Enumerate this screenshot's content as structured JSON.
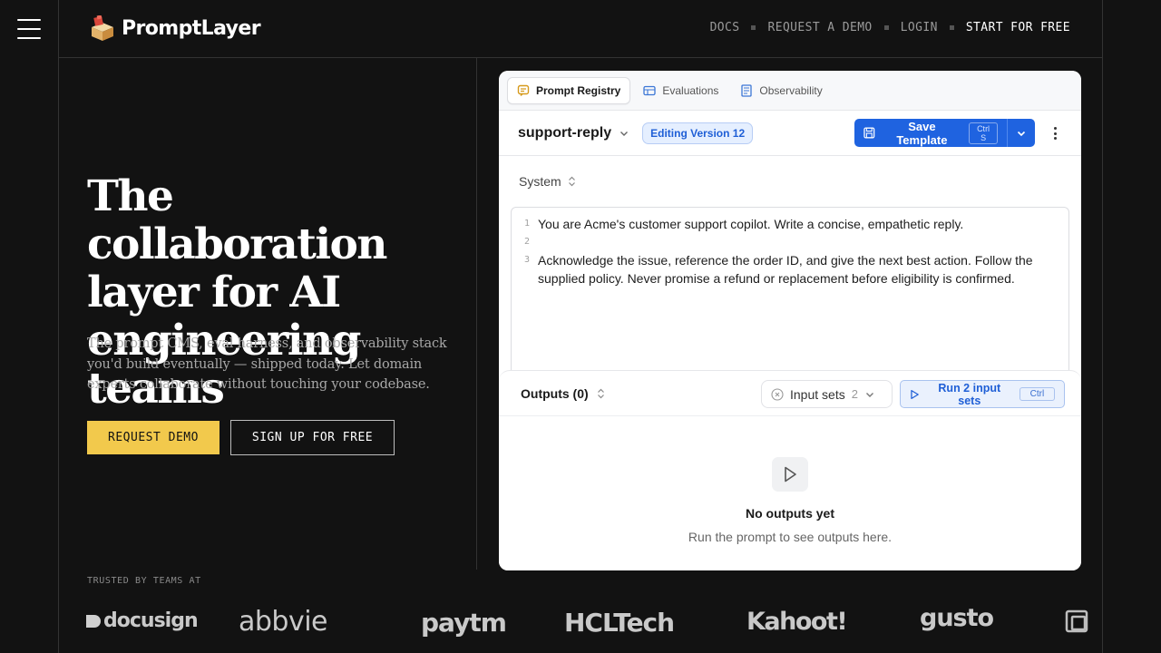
{
  "nav": {
    "logo_text": "PromptLayer",
    "links": [
      "DOCS",
      "REQUEST A DEMO",
      "LOGIN",
      "START FOR FREE"
    ]
  },
  "hero": {
    "title": "The collaboration layer for AI engineering teams",
    "subtitle": "The prompt CMS, eval harness, and observability stack you'd build eventually — shipped today. Let domain experts collaborate without touching your codebase.",
    "primary_cta": "REQUEST DEMO",
    "secondary_cta": "SIGN UP FOR FREE"
  },
  "trusted": {
    "label": "TRUSTED BY TEAMS AT",
    "logos": [
      "docusign",
      "abbvie",
      "paytm",
      "HCLTech",
      "Kahoot!",
      "gusto"
    ]
  },
  "app": {
    "tabs": [
      "Prompt Registry",
      "Evaluations",
      "Observability"
    ],
    "active_tab": "Prompt Registry",
    "template_name": "support-reply",
    "version_badge": "Editing Version 12",
    "save_label": "Save Template",
    "save_shortcut": "Ctrl S",
    "role": "System",
    "editor_lines": [
      {
        "num": "1",
        "text": "You are Acme's customer support copilot. Write a concise, empathetic reply."
      },
      {
        "num": "2",
        "text": ""
      },
      {
        "num": "3",
        "text": "Acknowledge the issue, reference the order ID, and give the next best action. Follow the supplied policy. Never promise a refund or replacement before eligibility is confirmed."
      }
    ],
    "outputs_title": "Outputs (0)",
    "input_sets_label": "Input sets",
    "input_sets_count": "2",
    "run_label": "Run 2 input sets",
    "run_shortcut": "Ctrl",
    "empty_title": "No outputs yet",
    "empty_sub": "Run the prompt to see outputs here."
  },
  "colors": {
    "background": "#121212",
    "accent_yellow": "#f2c94c",
    "primary_blue": "#1f63e0"
  }
}
